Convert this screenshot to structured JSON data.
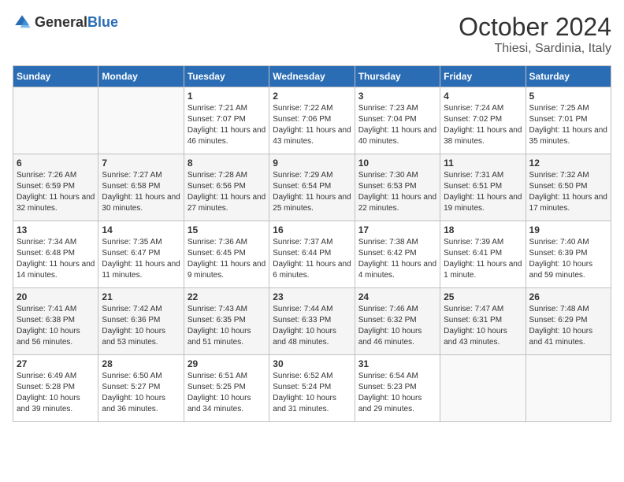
{
  "header": {
    "logo_general": "General",
    "logo_blue": "Blue",
    "month_title": "October 2024",
    "location": "Thiesi, Sardinia, Italy"
  },
  "weekdays": [
    "Sunday",
    "Monday",
    "Tuesday",
    "Wednesday",
    "Thursday",
    "Friday",
    "Saturday"
  ],
  "weeks": [
    [
      {
        "day": "",
        "info": ""
      },
      {
        "day": "",
        "info": ""
      },
      {
        "day": "1",
        "sunrise": "7:21 AM",
        "sunset": "7:07 PM",
        "daylight": "11 hours and 46 minutes."
      },
      {
        "day": "2",
        "sunrise": "7:22 AM",
        "sunset": "7:06 PM",
        "daylight": "11 hours and 43 minutes."
      },
      {
        "day": "3",
        "sunrise": "7:23 AM",
        "sunset": "7:04 PM",
        "daylight": "11 hours and 40 minutes."
      },
      {
        "day": "4",
        "sunrise": "7:24 AM",
        "sunset": "7:02 PM",
        "daylight": "11 hours and 38 minutes."
      },
      {
        "day": "5",
        "sunrise": "7:25 AM",
        "sunset": "7:01 PM",
        "daylight": "11 hours and 35 minutes."
      }
    ],
    [
      {
        "day": "6",
        "sunrise": "7:26 AM",
        "sunset": "6:59 PM",
        "daylight": "11 hours and 32 minutes."
      },
      {
        "day": "7",
        "sunrise": "7:27 AM",
        "sunset": "6:58 PM",
        "daylight": "11 hours and 30 minutes."
      },
      {
        "day": "8",
        "sunrise": "7:28 AM",
        "sunset": "6:56 PM",
        "daylight": "11 hours and 27 minutes."
      },
      {
        "day": "9",
        "sunrise": "7:29 AM",
        "sunset": "6:54 PM",
        "daylight": "11 hours and 25 minutes."
      },
      {
        "day": "10",
        "sunrise": "7:30 AM",
        "sunset": "6:53 PM",
        "daylight": "11 hours and 22 minutes."
      },
      {
        "day": "11",
        "sunrise": "7:31 AM",
        "sunset": "6:51 PM",
        "daylight": "11 hours and 19 minutes."
      },
      {
        "day": "12",
        "sunrise": "7:32 AM",
        "sunset": "6:50 PM",
        "daylight": "11 hours and 17 minutes."
      }
    ],
    [
      {
        "day": "13",
        "sunrise": "7:34 AM",
        "sunset": "6:48 PM",
        "daylight": "11 hours and 14 minutes."
      },
      {
        "day": "14",
        "sunrise": "7:35 AM",
        "sunset": "6:47 PM",
        "daylight": "11 hours and 11 minutes."
      },
      {
        "day": "15",
        "sunrise": "7:36 AM",
        "sunset": "6:45 PM",
        "daylight": "11 hours and 9 minutes."
      },
      {
        "day": "16",
        "sunrise": "7:37 AM",
        "sunset": "6:44 PM",
        "daylight": "11 hours and 6 minutes."
      },
      {
        "day": "17",
        "sunrise": "7:38 AM",
        "sunset": "6:42 PM",
        "daylight": "11 hours and 4 minutes."
      },
      {
        "day": "18",
        "sunrise": "7:39 AM",
        "sunset": "6:41 PM",
        "daylight": "11 hours and 1 minute."
      },
      {
        "day": "19",
        "sunrise": "7:40 AM",
        "sunset": "6:39 PM",
        "daylight": "10 hours and 59 minutes."
      }
    ],
    [
      {
        "day": "20",
        "sunrise": "7:41 AM",
        "sunset": "6:38 PM",
        "daylight": "10 hours and 56 minutes."
      },
      {
        "day": "21",
        "sunrise": "7:42 AM",
        "sunset": "6:36 PM",
        "daylight": "10 hours and 53 minutes."
      },
      {
        "day": "22",
        "sunrise": "7:43 AM",
        "sunset": "6:35 PM",
        "daylight": "10 hours and 51 minutes."
      },
      {
        "day": "23",
        "sunrise": "7:44 AM",
        "sunset": "6:33 PM",
        "daylight": "10 hours and 48 minutes."
      },
      {
        "day": "24",
        "sunrise": "7:46 AM",
        "sunset": "6:32 PM",
        "daylight": "10 hours and 46 minutes."
      },
      {
        "day": "25",
        "sunrise": "7:47 AM",
        "sunset": "6:31 PM",
        "daylight": "10 hours and 43 minutes."
      },
      {
        "day": "26",
        "sunrise": "7:48 AM",
        "sunset": "6:29 PM",
        "daylight": "10 hours and 41 minutes."
      }
    ],
    [
      {
        "day": "27",
        "sunrise": "6:49 AM",
        "sunset": "5:28 PM",
        "daylight": "10 hours and 39 minutes."
      },
      {
        "day": "28",
        "sunrise": "6:50 AM",
        "sunset": "5:27 PM",
        "daylight": "10 hours and 36 minutes."
      },
      {
        "day": "29",
        "sunrise": "6:51 AM",
        "sunset": "5:25 PM",
        "daylight": "10 hours and 34 minutes."
      },
      {
        "day": "30",
        "sunrise": "6:52 AM",
        "sunset": "5:24 PM",
        "daylight": "10 hours and 31 minutes."
      },
      {
        "day": "31",
        "sunrise": "6:54 AM",
        "sunset": "5:23 PM",
        "daylight": "10 hours and 29 minutes."
      },
      {
        "day": "",
        "info": ""
      },
      {
        "day": "",
        "info": ""
      }
    ]
  ],
  "labels": {
    "sunrise_prefix": "Sunrise: ",
    "sunset_prefix": "Sunset: ",
    "daylight_prefix": "Daylight: "
  }
}
